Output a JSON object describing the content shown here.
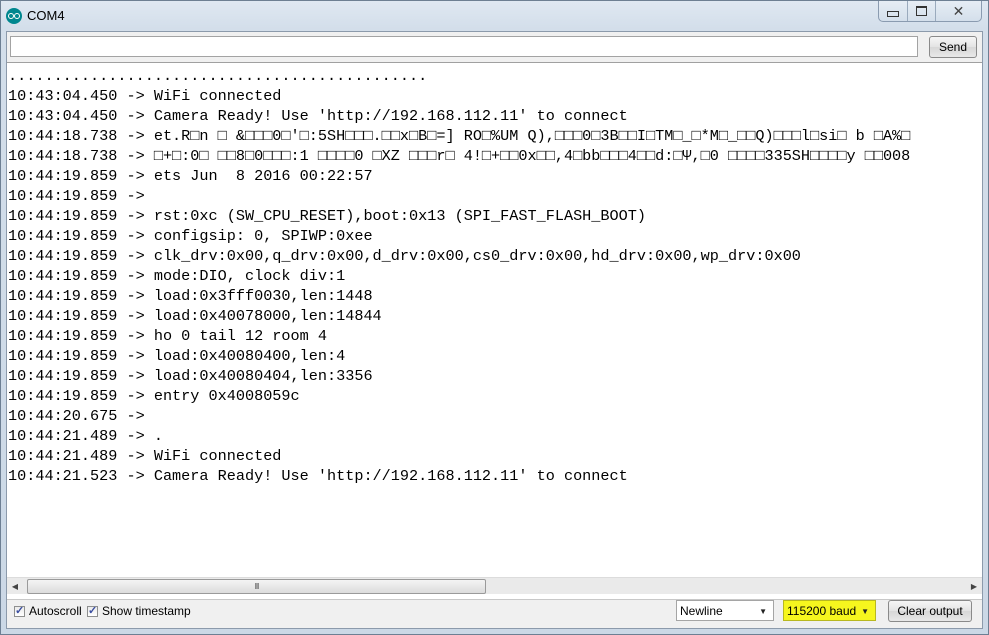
{
  "window": {
    "title": "COM4",
    "controls": {
      "minimize": "minimize",
      "maximize": "maximize",
      "close": "close"
    }
  },
  "send_bar": {
    "input_value": "",
    "input_placeholder": "",
    "send_label": "Send"
  },
  "output": {
    "lines": [
      "..............................................",
      "10:43:04.450 -> WiFi connected",
      "10:43:04.450 -> Camera Ready! Use 'http://192.168.112.11' to connect",
      "10:44:18.738 -> et.R□n □ &□□□0□'□:5SH□□□.□□x□B□=] RO□%UM Q),□□□0□3B□□I□TM□_□*M□_□□Q)□□□l□si□ b □A%□",
      "10:44:18.738 -> □+□:0□ □□8□0□□□:1 □□□□0 □XZ □□□r□ 4!□+□□0x□□,4□bb□□□4□□d:□Ψ,□0 □□□□335SH□□□□y □□008",
      "10:44:19.859 -> ets Jun  8 2016 00:22:57",
      "10:44:19.859 -> ",
      "10:44:19.859 -> rst:0xc (SW_CPU_RESET),boot:0x13 (SPI_FAST_FLASH_BOOT)",
      "10:44:19.859 -> configsip: 0, SPIWP:0xee",
      "10:44:19.859 -> clk_drv:0x00,q_drv:0x00,d_drv:0x00,cs0_drv:0x00,hd_drv:0x00,wp_drv:0x00",
      "10:44:19.859 -> mode:DIO, clock div:1",
      "10:44:19.859 -> load:0x3fff0030,len:1448",
      "10:44:19.859 -> load:0x40078000,len:14844",
      "10:44:19.859 -> ho 0 tail 12 room 4",
      "10:44:19.859 -> load:0x40080400,len:4",
      "10:44:19.859 -> load:0x40080404,len:3356",
      "10:44:19.859 -> entry 0x4008059c",
      "10:44:20.675 -> ",
      "10:44:21.489 -> .",
      "10:44:21.489 -> WiFi connected",
      "10:44:21.523 -> Camera Ready! Use 'http://192.168.112.11' to connect"
    ]
  },
  "scrollbar": {
    "thumb_grip": "III"
  },
  "footer": {
    "autoscroll_label": "Autoscroll",
    "autoscroll_checked": true,
    "timestamp_label": "Show timestamp",
    "timestamp_checked": true,
    "line_ending_selected": "Newline",
    "baud_selected": "115200 baud",
    "clear_label": "Clear output",
    "highlight_color": "#f2f20f"
  }
}
